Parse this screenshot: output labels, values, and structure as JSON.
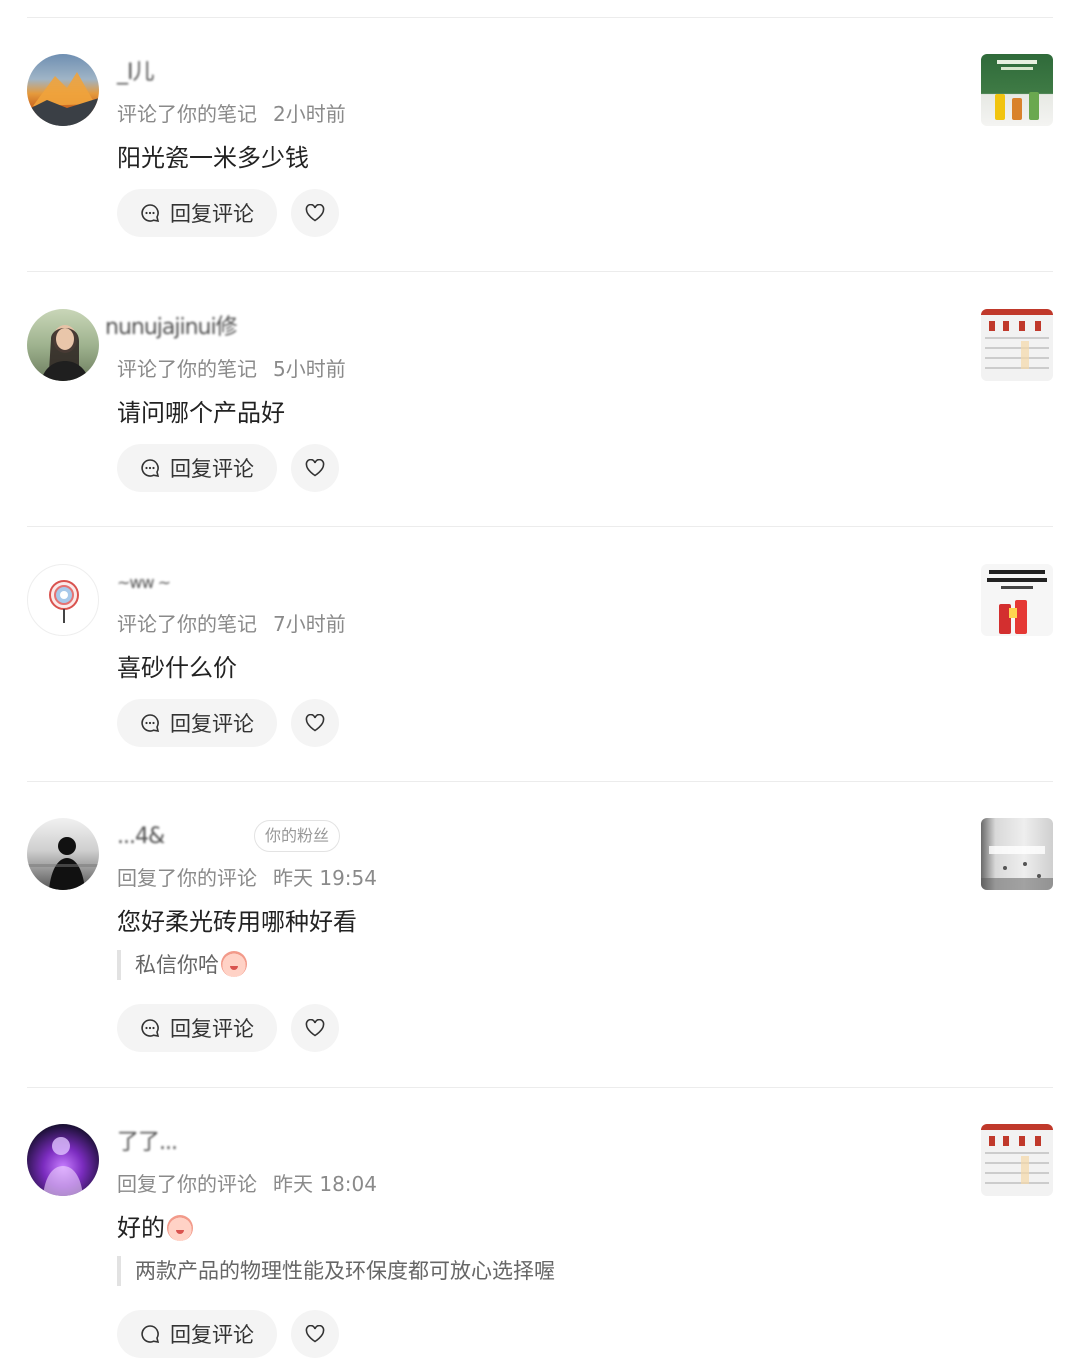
{
  "labels": {
    "reply_button": "回复评论",
    "fan_badge": "你的粉丝"
  },
  "colors": {
    "meta_text": "#8a8a8a",
    "button_bg": "#f4f4f4",
    "divider": "#ececec"
  },
  "notifications": [
    {
      "username": "_I儿",
      "action": "评论了你的笔记",
      "time": "2小时前",
      "comment": "阳光瓷一米多少钱",
      "avatar": "mountain-sunset-avatar",
      "thumbnail": "product-bottles-thumbnail"
    },
    {
      "username": "nunujajinui修",
      "action": "评论了你的笔记",
      "time": "5小时前",
      "comment": "请问哪个产品好",
      "avatar": "woman-portrait-avatar",
      "thumbnail": "product-comparison-thumbnail"
    },
    {
      "username": "~ww ~",
      "action": "评论了你的笔记",
      "time": "7小时前",
      "comment": "喜砂什么价",
      "avatar": "lollipop-avatar",
      "thumbnail": "red-products-thumbnail"
    },
    {
      "username": "...4&",
      "fan": true,
      "action": "回复了你的评论",
      "time": "昨天 19:54",
      "comment": "您好柔光砖用哪种好看",
      "quote": "私信你哈",
      "avatar": "silhouette-avatar",
      "thumbnail": "white-wall-thumbnail"
    },
    {
      "username": "了了...",
      "action": "回复了你的评论",
      "time": "昨天 18:04",
      "comment": "好的",
      "quote": "两款产品的物理性能及环保度都可放心选择喔",
      "avatar": "glowing-figure-avatar",
      "thumbnail": "product-comparison-thumbnail"
    }
  ]
}
